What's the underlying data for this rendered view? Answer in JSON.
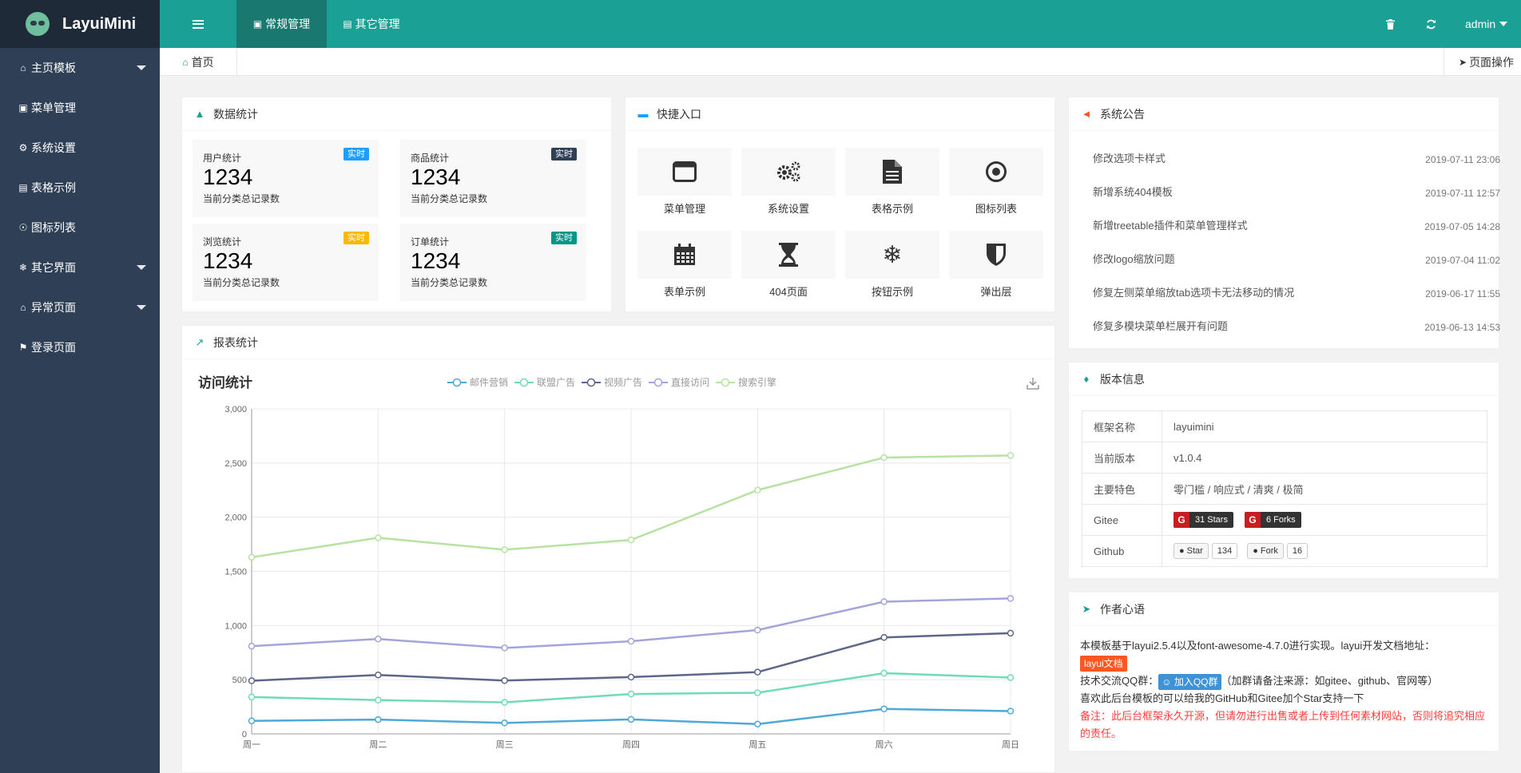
{
  "header": {
    "logo_text": "LayuiMini",
    "top_tabs": [
      {
        "label": "常规管理",
        "icon": "user-box-icon"
      },
      {
        "label": "其它管理",
        "icon": "slideshow-icon"
      }
    ],
    "user": "admin"
  },
  "sidebar": {
    "items": [
      {
        "label": "主页模板",
        "icon": "home-icon",
        "expandable": true
      },
      {
        "label": "菜单管理",
        "icon": "window-icon",
        "expandable": false
      },
      {
        "label": "系统设置",
        "icon": "gears-icon",
        "expandable": false
      },
      {
        "label": "表格示例",
        "icon": "file-icon",
        "expandable": false
      },
      {
        "label": "图标列表",
        "icon": "dot-circle-icon",
        "expandable": false
      },
      {
        "label": "其它界面",
        "icon": "snowflake-icon",
        "expandable": true
      },
      {
        "label": "异常页面",
        "icon": "home-icon",
        "expandable": true
      },
      {
        "label": "登录页面",
        "icon": "flag-icon",
        "expandable": false
      }
    ]
  },
  "tabbar": {
    "home": "首页",
    "page_ops": "页面操作"
  },
  "stats": {
    "title": "数据统计",
    "cards": [
      {
        "label": "用户统计",
        "badge": "实时",
        "badge_color": "#1e9fff",
        "value": "1234",
        "sub": "当前分类总记录数"
      },
      {
        "label": "商品统计",
        "badge": "实时",
        "badge_color": "#2f4056",
        "value": "1234",
        "sub": "当前分类总记录数"
      },
      {
        "label": "浏览统计",
        "badge": "实时",
        "badge_color": "#ffb800",
        "value": "1234",
        "sub": "当前分类总记录数"
      },
      {
        "label": "订单统计",
        "badge": "实时",
        "badge_color": "#009688",
        "value": "1234",
        "sub": "当前分类总记录数"
      }
    ]
  },
  "quick": {
    "title": "快捷入口",
    "items": [
      {
        "label": "菜单管理",
        "icon": "window-icon"
      },
      {
        "label": "系统设置",
        "icon": "gears-icon"
      },
      {
        "label": "表格示例",
        "icon": "file-text-icon"
      },
      {
        "label": "图标列表",
        "icon": "dot-circle-icon"
      },
      {
        "label": "表单示例",
        "icon": "calendar-icon"
      },
      {
        "label": "404页面",
        "icon": "hourglass-icon"
      },
      {
        "label": "按钮示例",
        "icon": "snowflake-icon"
      },
      {
        "label": "弹出层",
        "icon": "shield-icon"
      }
    ]
  },
  "notice": {
    "title": "系统公告",
    "items": [
      {
        "text": "修改选项卡样式",
        "date": "2019-07-11 23:06"
      },
      {
        "text": "新增系统404模板",
        "date": "2019-07-11 12:57"
      },
      {
        "text": "新增treetable插件和菜单管理样式",
        "date": "2019-07-05 14:28"
      },
      {
        "text": "修改logo缩放问题",
        "date": "2019-07-04 11:02"
      },
      {
        "text": "修复左侧菜单缩放tab选项卡无法移动的情况",
        "date": "2019-06-17 11:55"
      },
      {
        "text": "修复多模块菜单栏展开有问题",
        "date": "2019-06-13 14:53"
      }
    ]
  },
  "version": {
    "title": "版本信息",
    "rows": [
      {
        "key": "框架名称",
        "value": "layuimini"
      },
      {
        "key": "当前版本",
        "value": "v1.0.4"
      },
      {
        "key": "主要特色",
        "value": "零门槛 / 响应式 / 清爽 / 极简"
      }
    ],
    "gitee": {
      "key": "Gitee",
      "stars": "31 Stars",
      "forks": "6 Forks"
    },
    "github": {
      "key": "Github",
      "star_label": "Star",
      "star_count": "134",
      "fork_label": "Fork",
      "fork_count": "16"
    }
  },
  "author": {
    "title": "作者心语",
    "line1": "本模板基于layui2.5.4以及font-awesome-4.7.0进行实现。layui开发文档地址：",
    "doc_tag": "layui文档",
    "qq_prefix": "技术交流QQ群：",
    "qq_tag": "加入QQ群",
    "qq_suffix": "（加群请备注来源：如gitee、github、官网等）",
    "line3": "喜欢此后台模板的可以给我的GitHub和Gitee加个Star支持一下",
    "warning": "备注：此后台框架永久开源，但请勿进行出售或者上传到任何素材网站，否则将追究相应的责任。"
  },
  "report": {
    "title": "报表统计"
  },
  "chart_data": {
    "type": "line",
    "title": "访问统计",
    "categories": [
      "周一",
      "周二",
      "周三",
      "周四",
      "周五",
      "周六",
      "周日"
    ],
    "ylim": [
      0,
      3000
    ],
    "yticks": [
      "0",
      "500",
      "1,000",
      "1,500",
      "2,000",
      "2,500",
      "3,000"
    ],
    "grid": true,
    "legend_position": "top",
    "series": [
      {
        "name": "邮件营销",
        "color": "#4fa8d8",
        "values": [
          120,
          132,
          101,
          134,
          90,
          230,
          210
        ]
      },
      {
        "name": "联盟广告",
        "color": "#6fdcb8",
        "values": [
          340,
          312,
          291,
          368,
          380,
          560,
          520
        ]
      },
      {
        "name": "视频广告",
        "color": "#5d6688",
        "values": [
          490,
          544,
          492,
          524,
          570,
          890,
          930
        ]
      },
      {
        "name": "直接访问",
        "color": "#a4a4dc",
        "values": [
          810,
          876,
          793,
          855,
          958,
          1220,
          1250
        ]
      },
      {
        "name": "搜索引擎",
        "color": "#b7e2a2",
        "values": [
          1630,
          1810,
          1700,
          1790,
          2250,
          2550,
          2570
        ]
      }
    ]
  }
}
